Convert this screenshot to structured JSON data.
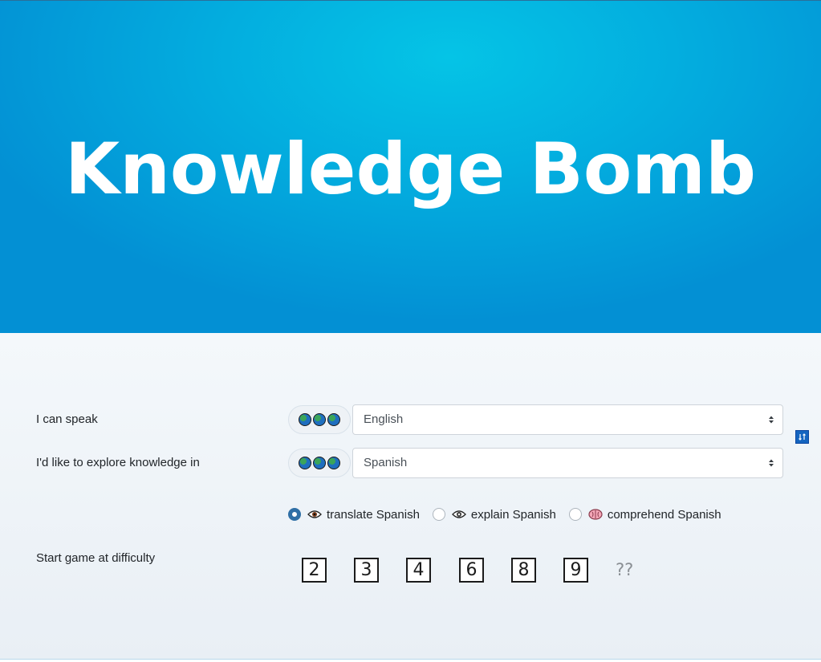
{
  "hero": {
    "title": "Knowledge Bomb"
  },
  "form": {
    "speak": {
      "label": "I can speak",
      "selected": "English"
    },
    "explore": {
      "label": "I'd like to explore knowledge in",
      "selected": "Spanish"
    },
    "swap_icon": "swap-icon",
    "modes": [
      {
        "label": "translate Spanish",
        "icon": "eye-icon",
        "checked": true
      },
      {
        "label": "explain Spanish",
        "icon": "eye-speech-icon",
        "checked": false
      },
      {
        "label": "comprehend Spanish",
        "icon": "brain-icon",
        "checked": false
      }
    ],
    "difficulty": {
      "label": "Start game at difficulty",
      "levels": [
        "2",
        "3",
        "4",
        "6",
        "8",
        "9"
      ],
      "unknown": "??"
    }
  },
  "colors": {
    "hero_light": "#05c4e6",
    "hero_dark": "#0390d4",
    "radio_checked": "#2f6fa6",
    "panel_bg": "#eef3f8"
  }
}
